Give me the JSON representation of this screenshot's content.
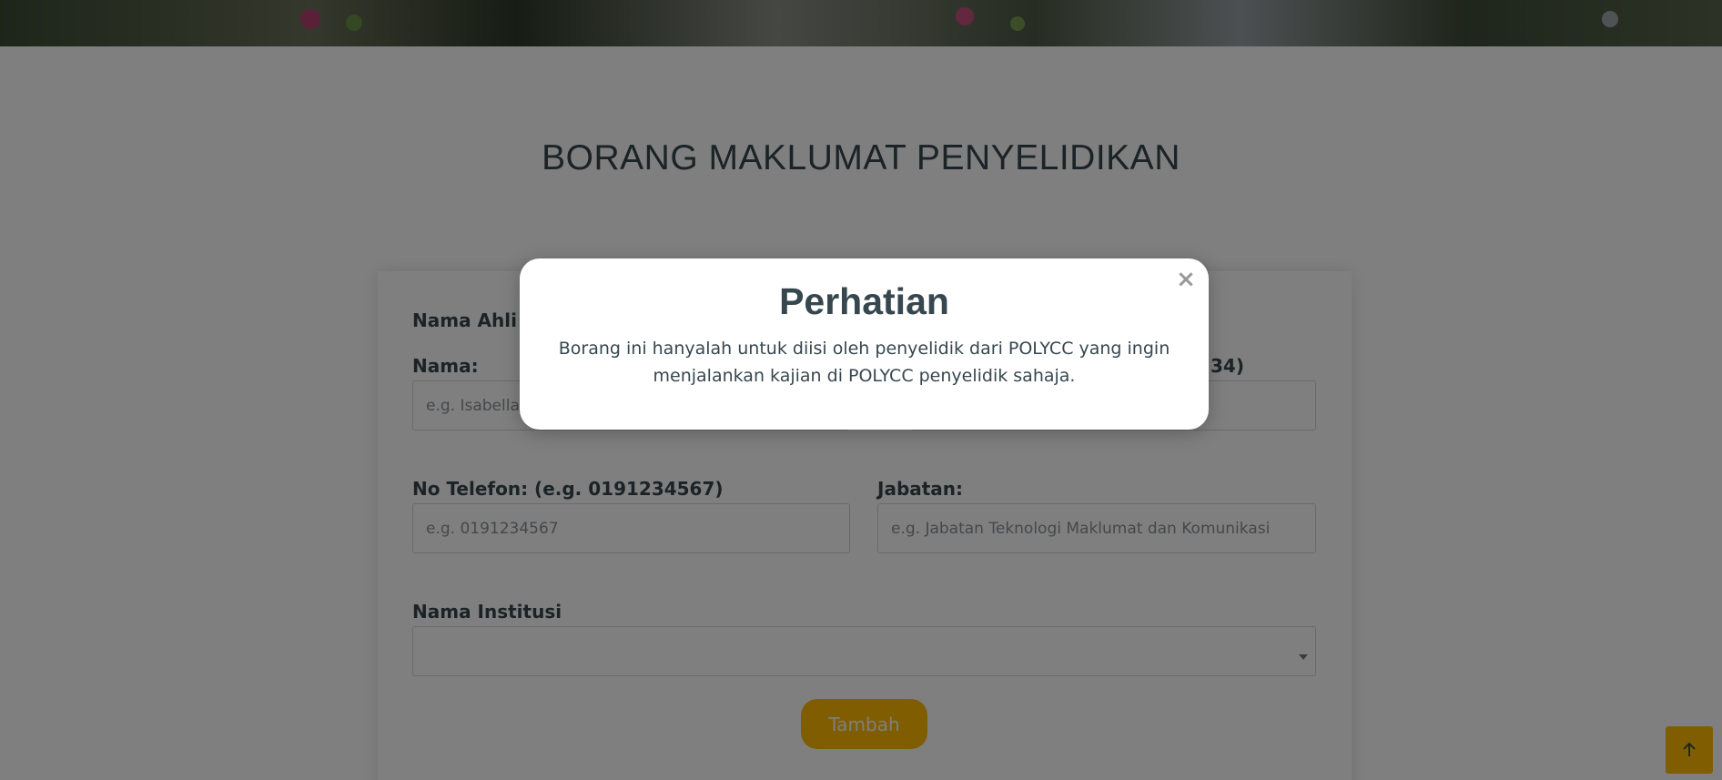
{
  "page": {
    "title": "BORANG MAKLUMAT PENYELIDIKAN"
  },
  "form": {
    "section_label": "Nama Ahli K",
    "nama_label": "Nama:",
    "nama_placeholder": "e.g. Isabella I",
    "right_label_fragment": "34)",
    "telefon_label": "No Telefon: (e.g. 0191234567)",
    "telefon_placeholder": "e.g. 0191234567",
    "jabatan_label": "Jabatan:",
    "jabatan_placeholder": "e.g. Jabatan Teknologi Maklumat dan Komunikasi",
    "institusi_label": "Nama Institusi",
    "institusi_value": "",
    "submit_label": "Tambah"
  },
  "modal": {
    "title": "Perhatian",
    "close_symbol": "×",
    "body": "Borang ini hanyalah untuk diisi oleh penyelidik dari POLYCC yang ingin menjalankan kajian di POLYCC penyelidik sahaja."
  },
  "back_to_top": {
    "icon": "arrow-up-icon"
  },
  "colors": {
    "accent": "#ffbb00",
    "text": "#37474f",
    "overlay": "rgba(0,0,0,0.5)"
  }
}
